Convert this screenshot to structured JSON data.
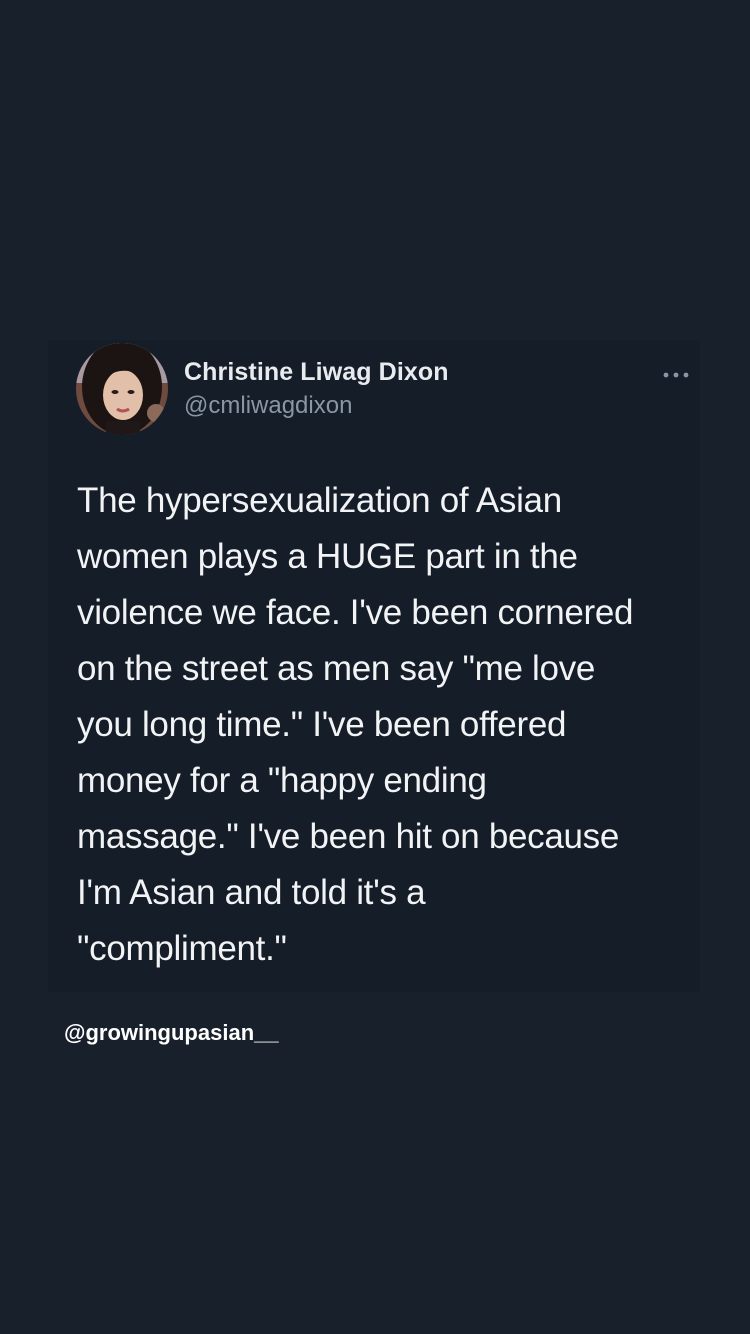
{
  "tweet": {
    "author_name": "Christine Liwag Dixon",
    "author_handle": "@cmliwagdixon",
    "more_icon": "more-horizontal-icon",
    "text": "The hypersexualization of Asian\nwomen plays a HUGE part in the\nviolence we face. I've been cornered\non the street as men say \"me love\nyou long time.\" I've been offered\nmoney for a \"happy ending\nmassage.\" I've been hit on because\nI'm Asian and told it's a\n\"compliment.\""
  },
  "watermark": {
    "text": "@growingupasian__"
  },
  "colors": {
    "background": "#18202b",
    "card": "#151d28",
    "text": "#f2f3f5",
    "handle": "#8a96a3"
  }
}
